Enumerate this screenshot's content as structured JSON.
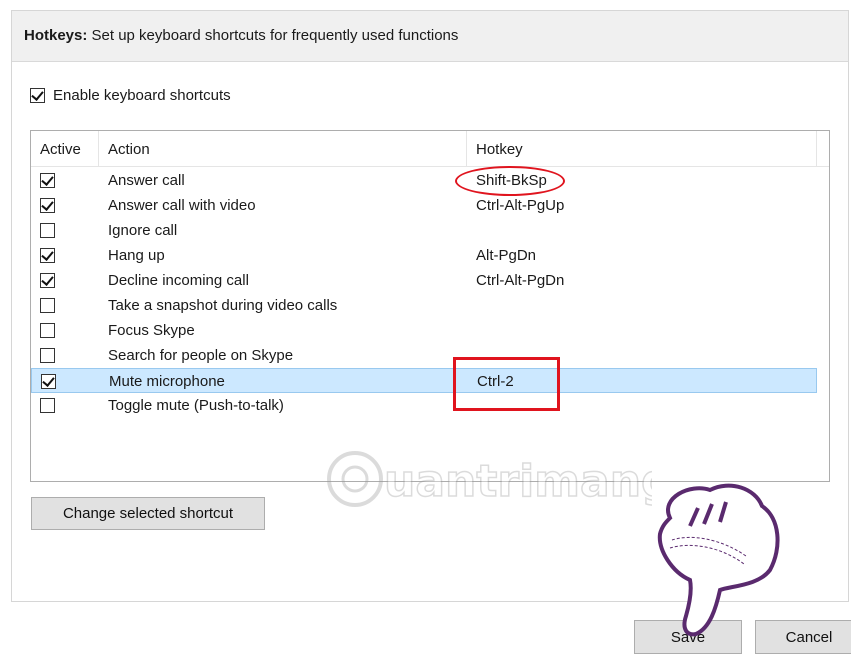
{
  "header": {
    "title_bold": "Hotkeys:",
    "title_text": " Set up keyboard shortcuts for frequently used functions"
  },
  "enable": {
    "label": "Enable keyboard shortcuts",
    "checked": true
  },
  "table": {
    "columns": [
      "Active",
      "Action",
      "Hotkey"
    ],
    "rows": [
      {
        "active": true,
        "action": "Answer call",
        "hotkey": "Shift-BkSp"
      },
      {
        "active": true,
        "action": "Answer call with video",
        "hotkey": "Ctrl-Alt-PgUp"
      },
      {
        "active": false,
        "action": "Ignore call",
        "hotkey": ""
      },
      {
        "active": true,
        "action": "Hang up",
        "hotkey": "Alt-PgDn"
      },
      {
        "active": true,
        "action": "Decline incoming call",
        "hotkey": "Ctrl-Alt-PgDn"
      },
      {
        "active": false,
        "action": "Take a snapshot during video calls",
        "hotkey": ""
      },
      {
        "active": false,
        "action": "Focus Skype",
        "hotkey": ""
      },
      {
        "active": false,
        "action": "Search for people on Skype",
        "hotkey": ""
      },
      {
        "active": true,
        "action": "Mute microphone",
        "hotkey": "Ctrl-2",
        "selected": true
      },
      {
        "active": false,
        "action": "Toggle mute (Push-to-talk)",
        "hotkey": ""
      }
    ]
  },
  "buttons": {
    "change_label": "Change selected shortcut",
    "save_label": "Save",
    "cancel_label": "Cancel"
  },
  "watermark": {
    "text": "uantrimang"
  },
  "colors": {
    "annotation_red": "#e0141e",
    "selection_bg": "#cce8ff",
    "hand_outline": "#5a2a6e"
  }
}
